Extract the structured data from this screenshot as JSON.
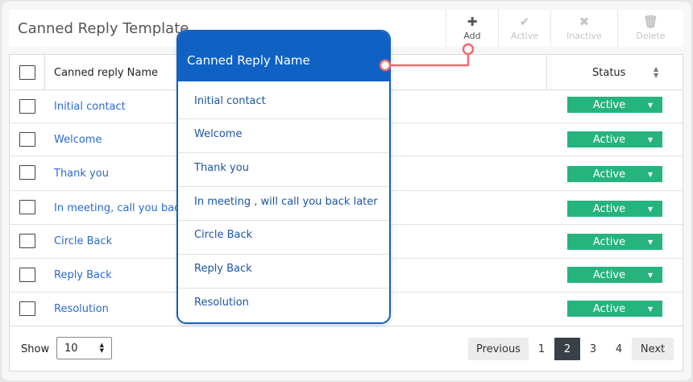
{
  "header": {
    "title": "Canned Reply Template",
    "tools": [
      {
        "name": "add",
        "label": "Add",
        "icon": "plus-icon",
        "enabled": true
      },
      {
        "name": "active",
        "label": "Active",
        "icon": "check-icon",
        "enabled": false
      },
      {
        "name": "inactive",
        "label": "Inactive",
        "icon": "x-icon",
        "enabled": false
      },
      {
        "name": "delete",
        "label": "Delete",
        "icon": "trash-icon",
        "enabled": false
      }
    ]
  },
  "table": {
    "columns": {
      "name": "Canned reply Name",
      "status": "Status"
    },
    "rows": [
      {
        "name": "Initial contact",
        "status": "Active"
      },
      {
        "name": "Welcome",
        "status": "Active"
      },
      {
        "name": "Thank you",
        "status": "Active"
      },
      {
        "name": "In meeting, call you back later",
        "status": "Active"
      },
      {
        "name": "Circle Back",
        "status": "Active"
      },
      {
        "name": "Reply Back",
        "status": "Active"
      },
      {
        "name": "Resolution",
        "status": "Active"
      }
    ]
  },
  "footer": {
    "show_label": "Show",
    "page_size": "10",
    "previous": "Previous",
    "pages": [
      "1",
      "2",
      "3",
      "4"
    ],
    "current_page": "2",
    "next": "Next"
  },
  "callout": {
    "title": "Canned Reply Name",
    "items": [
      "Initial contact",
      "Welcome",
      "Thank you",
      "In meeting , will call you back later",
      "Circle Back",
      "Reply Back",
      "Resolution"
    ]
  },
  "colors": {
    "status_active": "#25b47e",
    "callout_header": "#0f62c4",
    "link": "#2a6ad1",
    "connector": "#f06b6e",
    "active_page": "#3a4048"
  }
}
